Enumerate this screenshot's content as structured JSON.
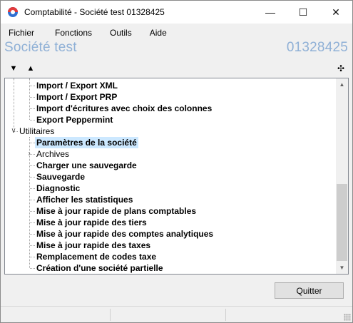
{
  "window": {
    "title": "Comptabilité - Société test 01328425",
    "minimize_glyph": "—",
    "maximize_glyph": "☐",
    "close_glyph": "✕"
  },
  "menu": [
    "Fichier",
    "Fonctions",
    "Outils",
    "Aide"
  ],
  "header": {
    "company_name": "Société test",
    "company_number": "01328425",
    "accent_color": "#8fb0d6"
  },
  "toolbar": {
    "down_arrow": "▼",
    "up_arrow": "▲",
    "expand_icon": "✣"
  },
  "tree": {
    "items": [
      {
        "label": "Import / Export XML",
        "bold": true
      },
      {
        "label": "Import / Export PRP",
        "bold": true
      },
      {
        "label": "Import d'écritures avec choix des colonnes",
        "bold": true
      },
      {
        "label": "Export Peppermint",
        "bold": true
      },
      {
        "label": "Utilitaires",
        "bold": false
      },
      {
        "label": "Paramètres de la société",
        "bold": true
      },
      {
        "label": "Archives",
        "bold": false
      },
      {
        "label": "Charger une sauvegarde",
        "bold": true
      },
      {
        "label": "Sauvegarde",
        "bold": true
      },
      {
        "label": "Diagnostic",
        "bold": true
      },
      {
        "label": "Afficher les statistiques",
        "bold": true
      },
      {
        "label": "Mise à jour rapide de plans comptables",
        "bold": true
      },
      {
        "label": "Mise à jour rapide des tiers",
        "bold": true
      },
      {
        "label": "Mise à jour rapide des comptes analytiques",
        "bold": true
      },
      {
        "label": "Mise à jour rapide des taxes",
        "bold": true
      },
      {
        "label": "Remplacement de codes taxe",
        "bold": true
      },
      {
        "label": "Création d'une société partielle",
        "bold": true
      }
    ],
    "expanded_glyph": "∨",
    "collapsed_glyph": "›",
    "selected_color": "#cce8ff"
  },
  "buttons": {
    "quit": "Quitter"
  }
}
